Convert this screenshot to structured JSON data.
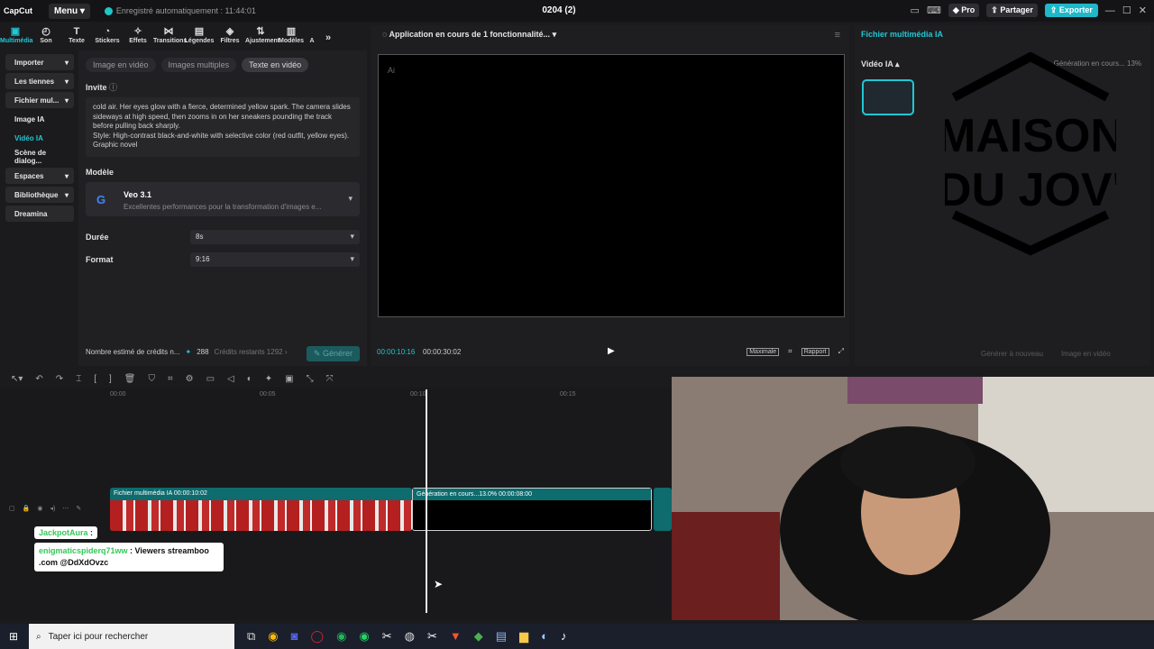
{
  "app": {
    "logo": "CapCut",
    "menu": "Menu",
    "autosave": "Enregistré automatiquement : 11:44:01",
    "project_title": "0204 (2)",
    "pro": "Pro",
    "share": "Partager",
    "export": "Exporter"
  },
  "toolbar": [
    {
      "icon": "media-icon",
      "label": "Multimédia"
    },
    {
      "icon": "sound-icon",
      "label": "Son"
    },
    {
      "icon": "text-icon",
      "label": "Texte"
    },
    {
      "icon": "sticker-icon",
      "label": "Stickers"
    },
    {
      "icon": "effects-icon",
      "label": "Effets"
    },
    {
      "icon": "transition-icon",
      "label": "Transitions"
    },
    {
      "icon": "subtitle-icon",
      "label": "Légendes"
    },
    {
      "icon": "filter-icon",
      "label": "Filtres"
    },
    {
      "icon": "adjust-icon",
      "label": "Ajustement"
    },
    {
      "icon": "template-icon",
      "label": "Modèles"
    },
    {
      "icon": "ai-icon",
      "label": "A"
    }
  ],
  "leftnav": [
    "Importer",
    "Les tiennes",
    "Fichier mul...",
    "Image IA",
    "Vidéo IA",
    "Scène de dialog...",
    "Espaces",
    "Bibliothèque",
    "Dreamina"
  ],
  "form": {
    "modes": [
      "Image en vidéo",
      "Images multiples",
      "Texte en vidéo"
    ],
    "invite_label": "Invite",
    "prompt": "cold air. Her eyes glow with a fierce, determined yellow spark. The camera slides sideways at high speed, then zooms in on her sneakers pounding the track before pulling back sharply.\nStyle: High-contrast black-and-white with selective color (red outfit, yellow eyes). Graphic novel",
    "model_label": "Modèle",
    "model_name": "Veo 3.1",
    "model_desc": "Excellentes performances pour la transformation d'images e...",
    "duration_label": "Durée",
    "duration": "8s",
    "format_label": "Format",
    "format": "9:16",
    "credits_label": "Nombre estimé de crédits n...",
    "credits": "288",
    "credits_left": "Crédits restants 1292",
    "generate": "Générer",
    "generate_badge": "288"
  },
  "player": {
    "status": "Application en cours de 1 fonctionnalité...",
    "ai_label": "Ai",
    "timecode": "00:00:10:16",
    "duration": "00:00:30:02",
    "maximize": "Maximale",
    "ratio": "Rapport"
  },
  "media": {
    "title": "Fichier multimédia IA",
    "section": "Vidéo IA",
    "status": "Génération en cours... 13%",
    "logo_l1": "MAISON",
    "logo_l2": "DU JOV'",
    "regen": "Générer à nouveau",
    "regen_badge": "288",
    "img_to_video": "Image en vidéo"
  },
  "timeline": {
    "ticks": [
      "00:00",
      "00:05",
      "00:10",
      "00:15"
    ],
    "clip1": "Fichier multimédia IA  00:00:10:02",
    "clip2": "Génération en cours...13.0%  00:00:08:00"
  },
  "chat": {
    "user1": "JackpotAura",
    "msg1": "",
    "user2": "enigmaticspiderq71ww",
    "msg2": ": Viewers streamboo .com @DdXdOvzc"
  },
  "taskbar": {
    "search": "Taper ici pour rechercher"
  }
}
